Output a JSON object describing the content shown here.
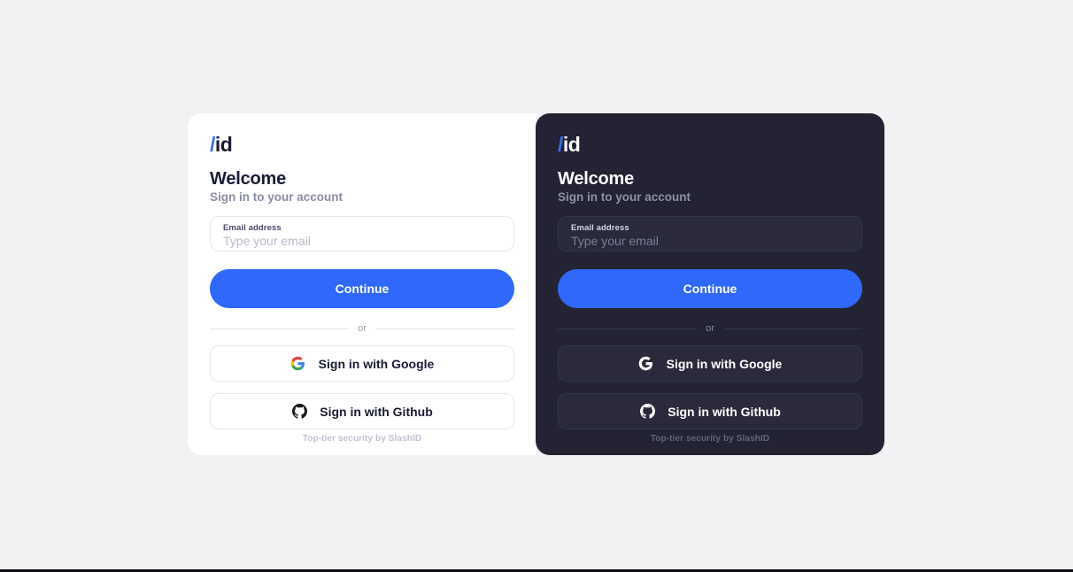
{
  "page": {
    "background_color": "#f2f2f4",
    "bottom_rule_color": "#0d0d12"
  },
  "brand": {
    "accent_color": "#2f68fb",
    "logo_slash": "/",
    "logo_name": "id"
  },
  "panels": [
    {
      "theme": "light",
      "background_color": "#ffffff",
      "logo_slash": "/",
      "logo_name": "id",
      "headline": "Welcome",
      "subhead": "Sign in to your account",
      "email_field": {
        "label": "Email address",
        "placeholder": "Type your email",
        "value": ""
      },
      "primary_button": "Continue",
      "divider_label": "or",
      "social_buttons": [
        {
          "icon": "google-icon",
          "label": "Sign in with Google"
        },
        {
          "icon": "github-icon",
          "label": "Sign in with Github"
        }
      ],
      "footer": "Top-tier security by SlashID"
    },
    {
      "theme": "dark",
      "background_color": "#232334",
      "logo_slash": "/",
      "logo_name": "id",
      "headline": "Welcome",
      "subhead": "Sign in to your account",
      "email_field": {
        "label": "Email address",
        "placeholder": "Type your email",
        "value": ""
      },
      "primary_button": "Continue",
      "divider_label": "or",
      "social_buttons": [
        {
          "icon": "google-icon",
          "label": "Sign in with Google"
        },
        {
          "icon": "github-icon",
          "label": "Sign in with Github"
        }
      ],
      "footer": "Top-tier security by SlashID"
    }
  ]
}
